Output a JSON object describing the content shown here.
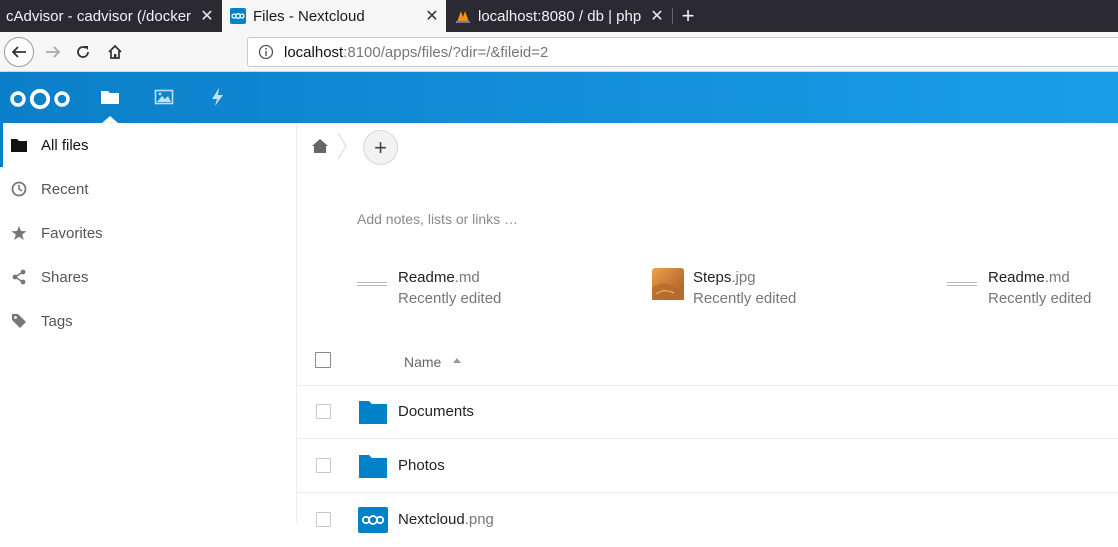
{
  "browser": {
    "tabs": [
      {
        "title": "cAdvisor - cadvisor (/docker",
        "active": false
      },
      {
        "title": "Files - Nextcloud",
        "active": true
      },
      {
        "title": "localhost:8080 / db | php",
        "active": false
      }
    ],
    "new_tab_label": "+",
    "url_host": "localhost",
    "url_rest": ":8100/apps/files/?dir=/&fileid=2"
  },
  "header": {
    "accent": "#0082c9",
    "apps": [
      {
        "name": "files",
        "icon": "folder-icon"
      },
      {
        "name": "photos",
        "icon": "image-icon"
      },
      {
        "name": "activity",
        "icon": "lightning-icon"
      }
    ]
  },
  "sidebar": {
    "items": [
      {
        "label": "All files",
        "icon": "folder-icon",
        "active": true
      },
      {
        "label": "Recent",
        "icon": "clock-icon",
        "active": false
      },
      {
        "label": "Favorites",
        "icon": "star-icon",
        "active": false
      },
      {
        "label": "Shares",
        "icon": "share-icon",
        "active": false
      },
      {
        "label": "Tags",
        "icon": "tag-icon",
        "active": false
      }
    ]
  },
  "main": {
    "add_label": "+",
    "notes_placeholder": "Add notes, lists or links …",
    "recent": [
      {
        "base": "Readme",
        "ext": ".md",
        "sub": "Recently edited"
      },
      {
        "base": "Steps",
        "ext": ".jpg",
        "sub": "Recently edited"
      },
      {
        "base": "Readme",
        "ext": ".md",
        "sub": "Recently edited"
      }
    ],
    "list_header": {
      "name": "Name"
    },
    "files": [
      {
        "base": "Documents",
        "ext": "",
        "type": "folder"
      },
      {
        "base": "Photos",
        "ext": "",
        "type": "folder"
      },
      {
        "base": "Nextcloud",
        "ext": ".png",
        "type": "image"
      }
    ]
  }
}
